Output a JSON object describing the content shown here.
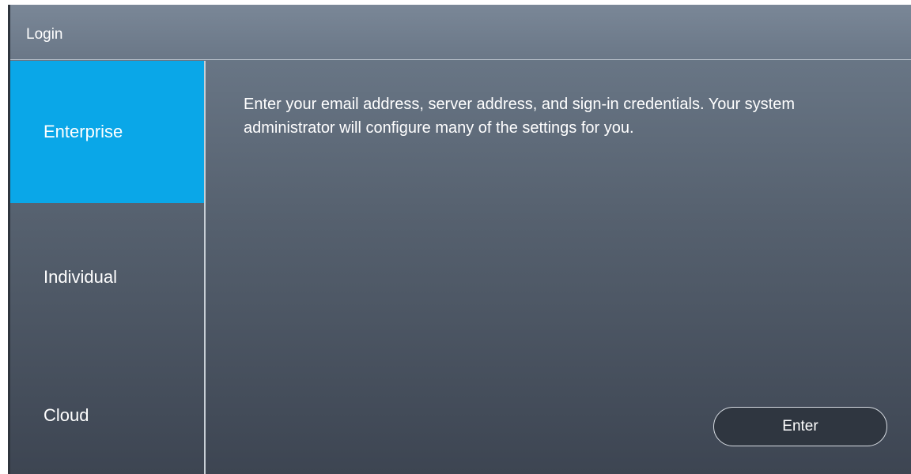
{
  "window": {
    "title": "Login"
  },
  "sidebar": {
    "items": [
      {
        "label": "Enterprise",
        "selected": true
      },
      {
        "label": "Individual",
        "selected": false
      },
      {
        "label": "Cloud",
        "selected": false
      }
    ]
  },
  "content": {
    "description": "Enter your email address, server address, and sign-in credentials. Your system administrator will configure many of the settings for you.",
    "enter_button_label": "Enter"
  },
  "colors": {
    "accent": "#0aa7e8",
    "button_background": "#2f3640",
    "text": "#ffffff"
  }
}
